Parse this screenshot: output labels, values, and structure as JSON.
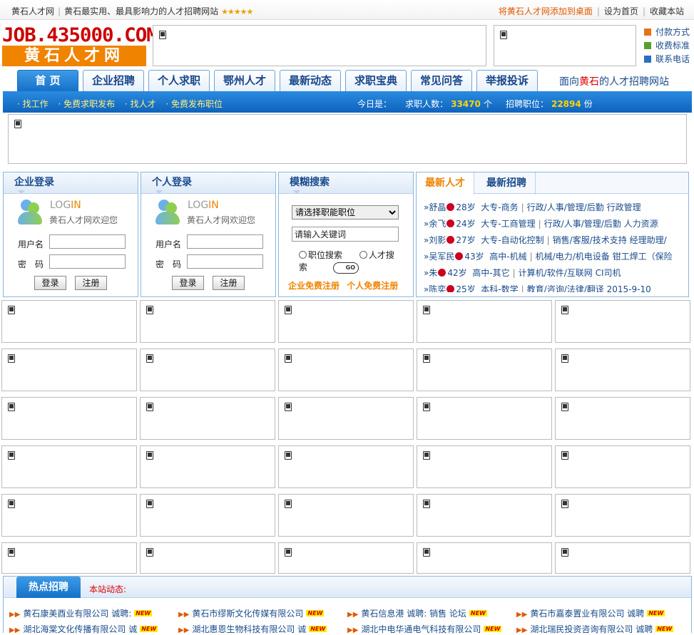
{
  "topbar": {
    "site_name": "黄石人才网",
    "tagline": "黄石最实用、最具影响力的人才招聘网站",
    "stars": "★★★★★",
    "add_desktop": "将黄石人才网添加到桌面",
    "set_home": "设为首页",
    "bookmark": "收藏本站"
  },
  "logo": {
    "line1": "JOB.435000.COM",
    "line2": "黄石人才网"
  },
  "right_links": [
    "付款方式",
    "收费标准",
    "联系电话"
  ],
  "nav": {
    "tabs": [
      "首 页",
      "企业招聘",
      "个人求职",
      "鄂州人才",
      "最新动态",
      "求职宝典",
      "常见问答",
      "举报投诉"
    ],
    "slogan_pre": "面向",
    "slogan_city": "黄石",
    "slogan_post": "的人才招聘网站"
  },
  "bluebar": {
    "links": [
      "· 找工作",
      "· 免费求职发布",
      "· 找人才",
      "· 免费发布职位"
    ],
    "today_label": "今日是：",
    "seekers_label": "求职人数：",
    "seekers": "33470",
    "seekers_unit": "个",
    "jobs_label": "招聘职位：",
    "jobs": "22894",
    "jobs_unit": "份"
  },
  "company_login": {
    "title": "企业登录",
    "login_log": "LOG",
    "login_in": "IN",
    "welcome": "黄石人才网欢迎您",
    "user_label": "用户名",
    "pass_label": "密　码",
    "login_btn": "登录",
    "register_btn": "注册"
  },
  "personal_login": {
    "title": "个人登录",
    "login_log": "LOG",
    "login_in": "IN",
    "welcome": "黄石人才网欢迎您",
    "user_label": "用户名",
    "pass_label": "密　码",
    "login_btn": "登录",
    "register_btn": "注册"
  },
  "search": {
    "title": "模糊搜索",
    "select_value": "请选择职能职位",
    "keyword_value": "请输入关键词",
    "radio_job": "职位搜索",
    "radio_talent": "人才搜索",
    "go": "GO",
    "reg_company": "企业免费注册",
    "reg_personal": "个人免费注册"
  },
  "talent": {
    "tab_active": "最新人才",
    "tab_other": "最新招聘",
    "rows": [
      {
        "name": "舒晶",
        "age": "28岁",
        "edu": "大专-商务",
        "cat": "行政/人事/管理/后勤",
        "job": "行政管理"
      },
      {
        "name": "余飞",
        "age": "24岁",
        "edu": "大专-工商管理",
        "cat": "行政/人事/管理/后勤",
        "job": "人力资源"
      },
      {
        "name": "刘影",
        "age": "27岁",
        "edu": "大专-自动化控制",
        "cat": "销售/客服/技术支持",
        "job": "经理助理/"
      },
      {
        "name": "吴军民",
        "age": "43岁",
        "edu": "高中-机械",
        "cat": "机械/电力/机电设备",
        "job": "钳工焊工（保险"
      },
      {
        "name": "朱",
        "age": "42岁",
        "edu": "高中-其它",
        "cat": "计算机/软件/互联网",
        "job": "CI司机"
      },
      {
        "name": "陈奕",
        "age": "25岁",
        "edu": "本科-数学",
        "cat": "教育/咨询/法律/翻译",
        "job": "2015-9-10"
      }
    ]
  },
  "hot": {
    "title": "热点招聘",
    "news_label": "本站动态:",
    "items_row1": [
      {
        "text": "黄石康美酉业有限公司  诚聘:",
        "new": "NEW"
      },
      {
        "text": "黄石市缪斯文化传媒有限公司",
        "new": "NEW"
      },
      {
        "text": "黄石信息港  诚聘: 销售 论坛",
        "new": "NEW"
      },
      {
        "text": "黄石市嘉泰置业有限公司  诚聘",
        "new": "NEW"
      }
    ],
    "items_row2": [
      {
        "text": "湖北海棠文化传播有限公司  诚",
        "new": "NEW"
      },
      {
        "text": "湖北惠恩生物科技有限公司  诚",
        "new": "NEW"
      },
      {
        "text": "湖北中电华通电气科技有限公司",
        "new": "NEW"
      },
      {
        "text": "湖北瑞民投资咨询有限公司  诚聘",
        "new": "NEW"
      }
    ]
  }
}
